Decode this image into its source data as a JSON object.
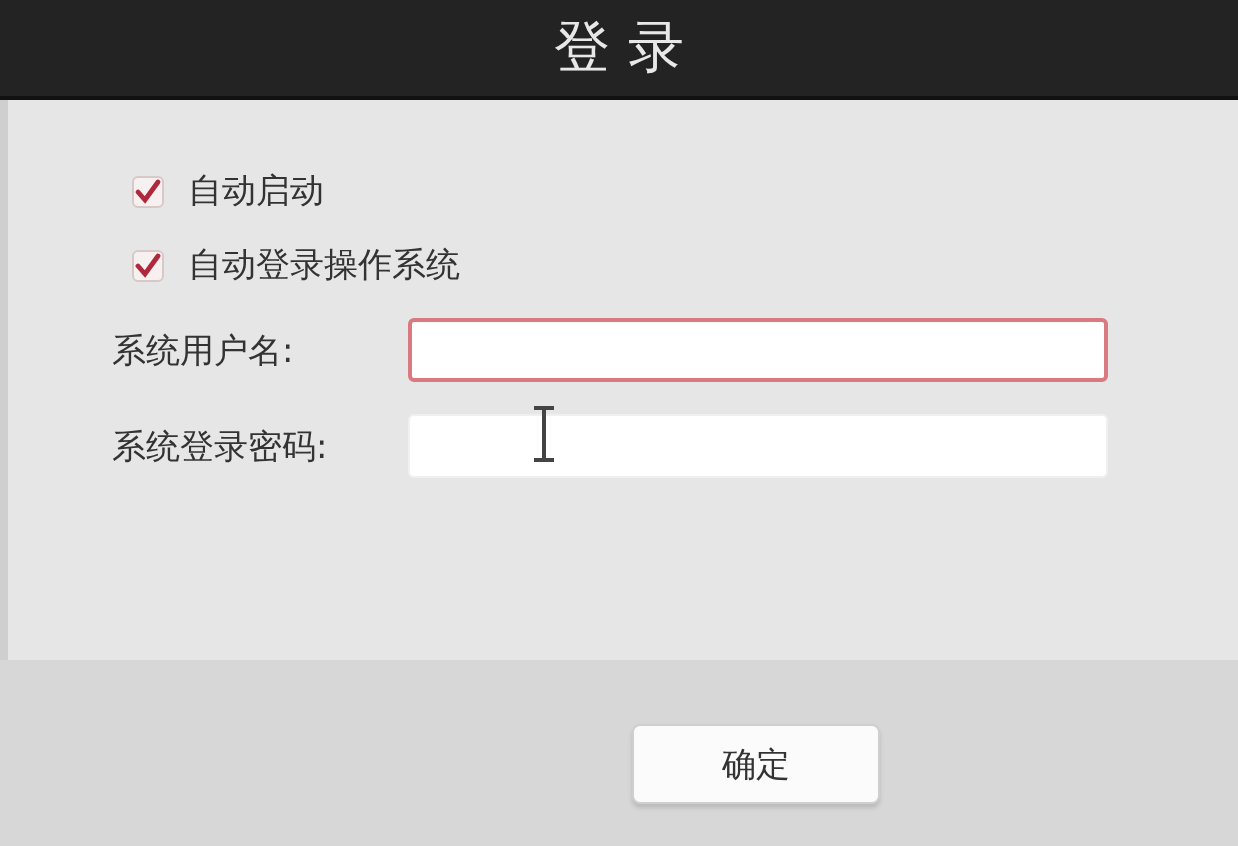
{
  "window": {
    "title": "登 录"
  },
  "options": [
    {
      "label": "自动启动",
      "checked": true
    },
    {
      "label": "自动登录操作系统",
      "checked": true
    }
  ],
  "fields": [
    {
      "label": "系统用户名:",
      "focused": true
    },
    {
      "label": "系统登录密码:",
      "focused": false
    }
  ],
  "buttons": [
    "确定"
  ]
}
